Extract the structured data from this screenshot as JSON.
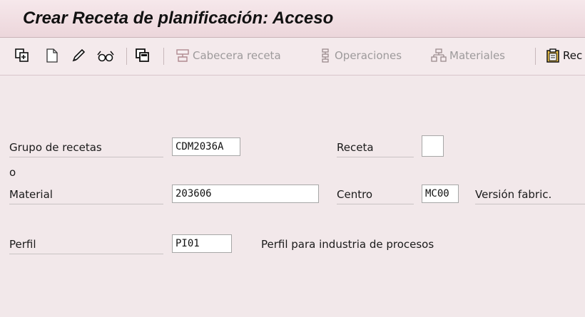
{
  "window": {
    "title": "Crear Receta de planificación: Acceso"
  },
  "toolbar": {
    "items": [
      {
        "icon": "copy-from-icon"
      },
      {
        "icon": "new-document-icon"
      },
      {
        "icon": "pencil-icon"
      },
      {
        "icon": "glasses-icon"
      },
      {
        "icon": "other-object-icon"
      },
      {
        "icon": "header-icon",
        "label": "Cabecera receta"
      },
      {
        "icon": "operations-icon",
        "label": "Operaciones"
      },
      {
        "icon": "materials-icon",
        "label": "Materiales"
      },
      {
        "icon": "clipboard-icon",
        "label": "Rec"
      }
    ]
  },
  "form": {
    "recipe_group_label": "Grupo de recetas",
    "recipe_group_value": "CDM2036A",
    "recipe_label": "Receta",
    "recipe_value": "",
    "or_label": "o",
    "material_label": "Material",
    "material_value": "203606",
    "plant_label": "Centro",
    "plant_value": "MC00",
    "version_label": "Versión fabric.",
    "profile_label": "Perfil",
    "profile_value": "PI01",
    "profile_description": "Perfil para industria de procesos"
  },
  "colors": {
    "background": "#f2e8ea",
    "toolbar_disabled_text": "#9d9a9b",
    "input_background": "#ffffff"
  }
}
